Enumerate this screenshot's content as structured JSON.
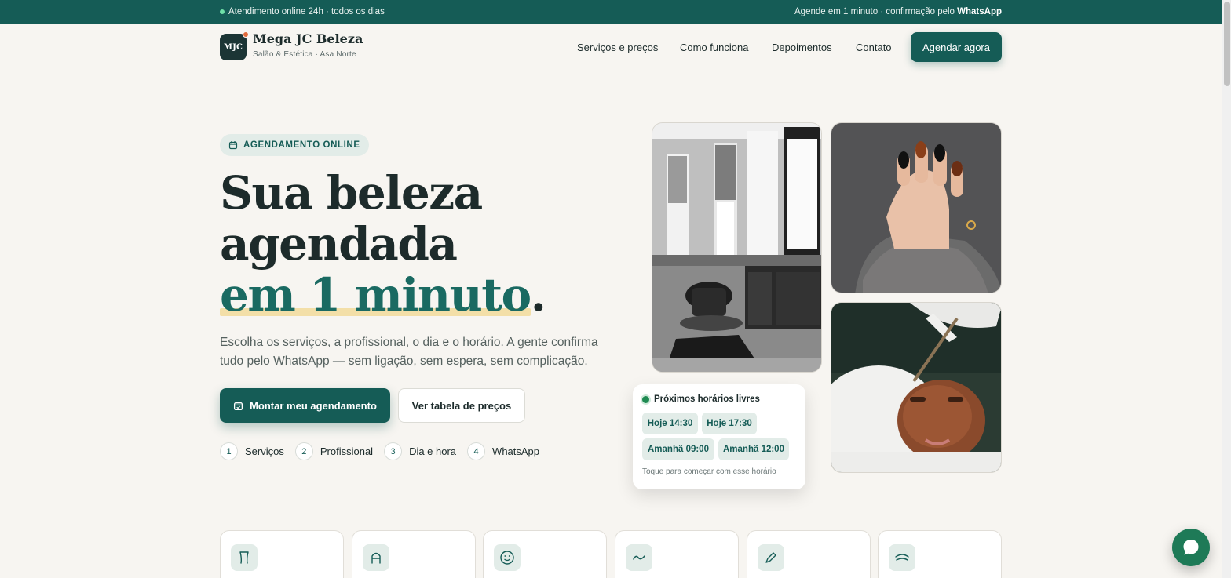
{
  "topbar": {
    "left_text": "Atendimento online 24h · todos os dias",
    "right_prefix": "Agende em 1 minuto · confirmação pelo",
    "right_bold": "WhatsApp"
  },
  "brand": {
    "badge": "MJC",
    "name": "Mega JC Beleza",
    "subtitle": "Salão & Estética · Asa Norte"
  },
  "nav": {
    "items": [
      "Serviços e preços",
      "Como funciona",
      "Depoimentos",
      "Contato"
    ],
    "cta": "Agendar agora"
  },
  "hero": {
    "pill": "AGENDAMENTO ONLINE",
    "headline_line1": "Sua beleza",
    "headline_line2": "agendada",
    "headline_accent": "em 1 minuto",
    "headline_period": ".",
    "lede": "Escolha os serviços, a profissional, o dia e o horário. A gente confirma tudo pelo WhatsApp — sem ligação, sem espera, sem complicação.",
    "primary_button": "Montar meu agendamento",
    "secondary_button": "Ver tabela de preços",
    "steps": [
      {
        "num": "1",
        "label": "Serviços"
      },
      {
        "num": "2",
        "label": "Profissional"
      },
      {
        "num": "3",
        "label": "Dia e hora"
      },
      {
        "num": "4",
        "label": "WhatsApp"
      }
    ]
  },
  "availability": {
    "title": "Próximos horários livres",
    "slots": [
      "Hoje 14:30",
      "Hoje 17:30",
      "Amanhã 09:00",
      "Amanhã 12:00"
    ],
    "hint": "Toque para começar com esse horário"
  },
  "service_icons": [
    "hair-dryer-icon",
    "letter-a-icon",
    "smile-face-icon",
    "wave-icon",
    "pen-nib-icon",
    "eyebrow-icon"
  ],
  "colors": {
    "brand": "#155c56",
    "accent_highlight": "#f3dfa8",
    "background": "#f7f5f1",
    "chat": "#1e7a57"
  }
}
